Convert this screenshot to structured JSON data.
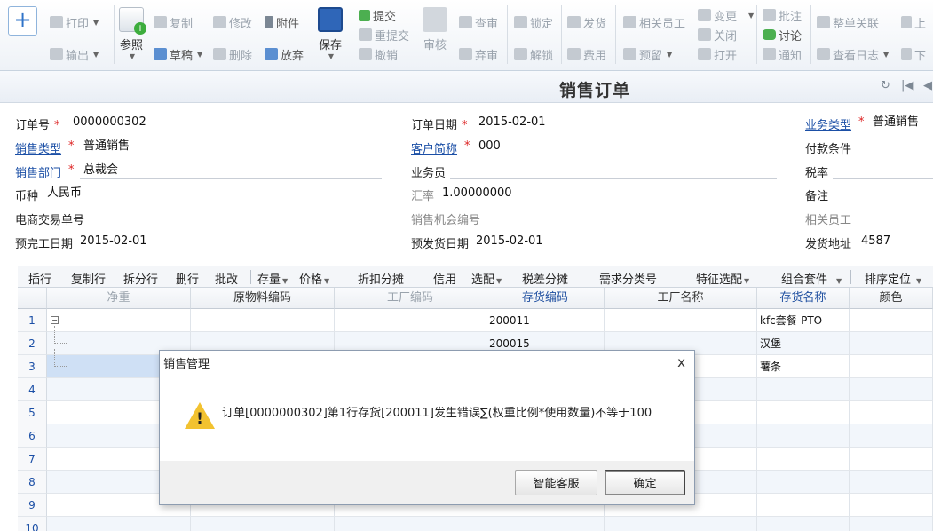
{
  "toolbar": {
    "add_icon": "plus-icon",
    "print": "打印",
    "export": "输出",
    "reference": "参照",
    "copy": "复制",
    "draft": "草稿",
    "modify": "修改",
    "delete": "删除",
    "attach": "附件",
    "discard": "放弃",
    "save": "保存",
    "submit": "提交",
    "resubmit": "重提交",
    "withdraw": "撤销",
    "audit": "审核",
    "review": "查审",
    "abandon": "弃审",
    "lock": "锁定",
    "unlock": "解锁",
    "ship": "发货",
    "expense": "费用",
    "related_staff": "相关员工",
    "reserve": "预留",
    "change": "变更",
    "close": "关闭",
    "open": "打开",
    "annotate": "批注",
    "discuss": "讨论",
    "notify": "通知",
    "whole_link": "整单关联",
    "view_log": "查看日志",
    "up": "上",
    "down": "下"
  },
  "title": "销售订单",
  "form": {
    "order_no": {
      "label": "订单号",
      "value": "0000000302"
    },
    "order_date": {
      "label": "订单日期",
      "value": "2015-02-01"
    },
    "biz_type": {
      "label": "业务类型",
      "value": "普通销售"
    },
    "sales_type": {
      "label": "销售类型",
      "value": "普通销售"
    },
    "customer": {
      "label": "客户简称",
      "value": "000"
    },
    "pay_terms": {
      "label": "付款条件",
      "value": ""
    },
    "sales_dept": {
      "label": "销售部门",
      "value": "总裁会"
    },
    "salesman": {
      "label": "业务员",
      "value": ""
    },
    "tax_rate": {
      "label": "税率",
      "value": ""
    },
    "currency": {
      "label": "币种",
      "value": "人民币"
    },
    "exch_rate": {
      "label": "汇率",
      "value": "1.00000000"
    },
    "remark": {
      "label": "备注",
      "value": ""
    },
    "ec_no": {
      "label": "电商交易单号",
      "value": ""
    },
    "opp_no": {
      "label": "销售机会编号",
      "value": ""
    },
    "related_staff": {
      "label": "相关员工",
      "value": ""
    },
    "finish_date": {
      "label": "预完工日期",
      "value": "2015-02-01"
    },
    "ship_date": {
      "label": "预发货日期",
      "value": "2015-02-01"
    },
    "ship_addr": {
      "label": "发货地址",
      "value": "4587"
    }
  },
  "gridbar": [
    "插行",
    "复制行",
    "拆分行",
    "删行",
    "批改",
    "存量",
    "价格",
    "折扣分摊",
    "信用",
    "选配",
    "税差分摊",
    "需求分类号",
    "特征选配",
    "组合套件",
    "排序定位"
  ],
  "grid": {
    "columns": [
      "净重",
      "原物料编码",
      "工厂编码",
      "存货编码",
      "工厂名称",
      "存货名称",
      "颜色"
    ],
    "rows": [
      {
        "n": "1",
        "code": "200011",
        "name": "kfc套餐-PTO"
      },
      {
        "n": "2",
        "code": "200015",
        "name": "汉堡"
      },
      {
        "n": "3",
        "code": "",
        "name": "薯条"
      },
      {
        "n": "4",
        "code": "",
        "name": ""
      },
      {
        "n": "5",
        "code": "",
        "name": ""
      },
      {
        "n": "6",
        "code": "",
        "name": ""
      },
      {
        "n": "7",
        "code": "",
        "name": ""
      },
      {
        "n": "8",
        "code": "",
        "name": ""
      },
      {
        "n": "9",
        "code": "",
        "name": ""
      },
      {
        "n": "10",
        "code": "",
        "name": ""
      }
    ]
  },
  "dialog": {
    "title": "销售管理",
    "close": "x",
    "message": "订单[0000000302]第1行存货[200011]发生错误∑(权重比例*使用数量)不等于100",
    "icon": "warning-icon",
    "btn_service": "智能客服",
    "btn_ok": "确定"
  }
}
